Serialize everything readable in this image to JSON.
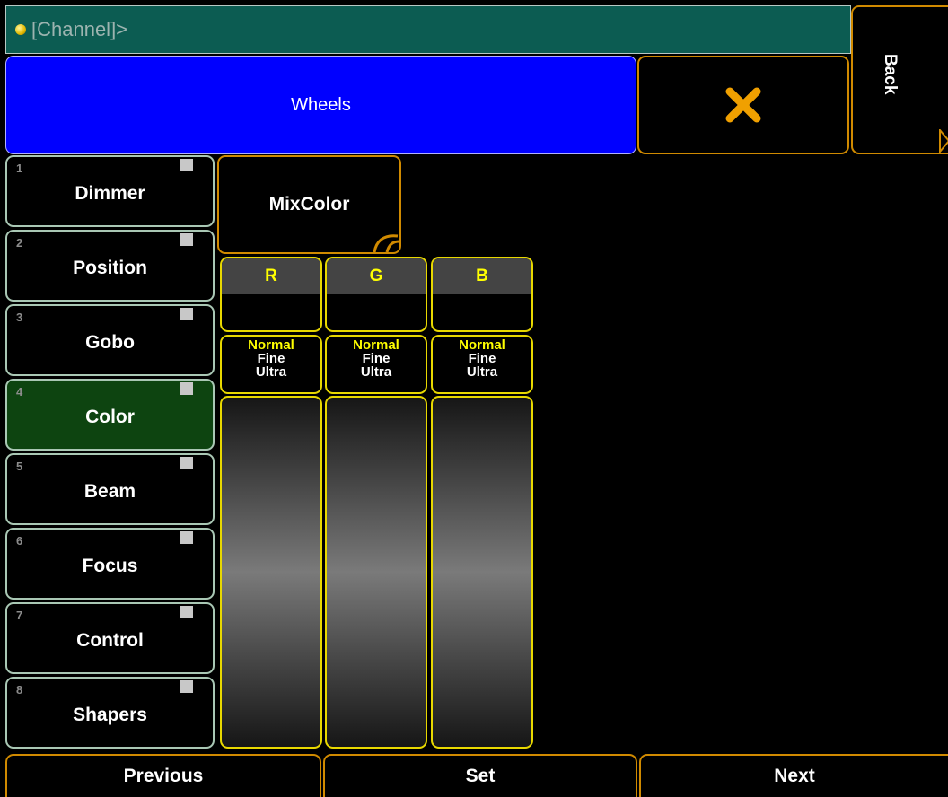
{
  "command_line": {
    "text": "[Channel]>"
  },
  "header": {
    "title": "Wheels",
    "back_label": "Back"
  },
  "preset_types": [
    {
      "num": "1",
      "label": "Dimmer"
    },
    {
      "num": "2",
      "label": "Position"
    },
    {
      "num": "3",
      "label": "Gobo"
    },
    {
      "num": "4",
      "label": "Color",
      "active": true
    },
    {
      "num": "5",
      "label": "Beam"
    },
    {
      "num": "6",
      "label": "Focus"
    },
    {
      "num": "7",
      "label": "Control"
    },
    {
      "num": "8",
      "label": "Shapers"
    }
  ],
  "feature": {
    "label": "MixColor"
  },
  "channels": [
    {
      "label": "R",
      "resolution": [
        "Normal",
        "Fine",
        "Ultra"
      ]
    },
    {
      "label": "G",
      "resolution": [
        "Normal",
        "Fine",
        "Ultra"
      ]
    },
    {
      "label": "B",
      "resolution": [
        "Normal",
        "Fine",
        "Ultra"
      ]
    }
  ],
  "footer": {
    "previous": "Previous",
    "set": "Set",
    "next": "Next"
  },
  "colors": {
    "command_line_bg": "#0c5c52",
    "title_bg": "#0000ff",
    "accent_orange": "#d08a00",
    "channel_yellow": "#ffff00",
    "active_preset_bg": "#0d4410"
  }
}
